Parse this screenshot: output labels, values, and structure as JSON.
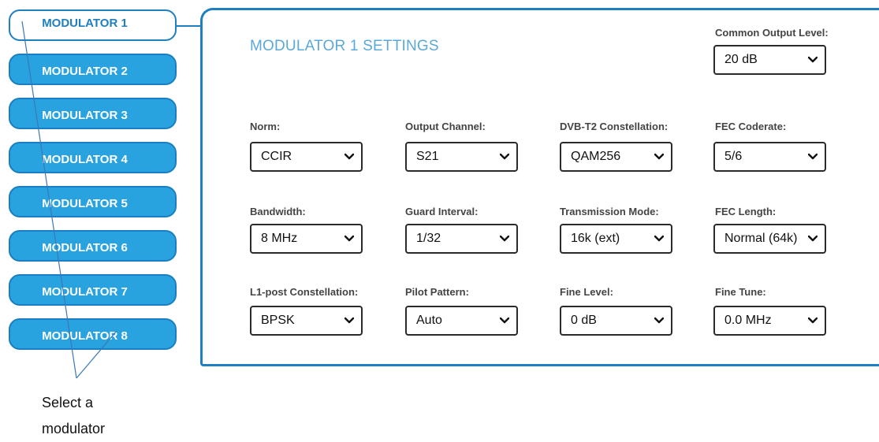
{
  "tabs": [
    {
      "label": "MODULATOR 1",
      "active": true
    },
    {
      "label": "MODULATOR 2",
      "active": false
    },
    {
      "label": "MODULATOR 3",
      "active": false
    },
    {
      "label": "MODULATOR 4",
      "active": false
    },
    {
      "label": "MODULATOR 5",
      "active": false
    },
    {
      "label": "MODULATOR 6",
      "active": false
    },
    {
      "label": "MODULATOR 7",
      "active": false
    },
    {
      "label": "MODULATOR 8",
      "active": false
    }
  ],
  "panel": {
    "title": "MODULATOR 1 SETTINGS",
    "common_output_level": {
      "label": "Common Output Level:",
      "value": "20 dB"
    },
    "fields": [
      {
        "label": "Norm:",
        "value": "CCIR"
      },
      {
        "label": "Output Channel:",
        "value": "S21"
      },
      {
        "label": "DVB-T2 Constellation:",
        "value": "QAM256"
      },
      {
        "label": "FEC Coderate:",
        "value": "5/6"
      },
      {
        "label": "Bandwidth:",
        "value": "8 MHz"
      },
      {
        "label": "Guard Interval:",
        "value": "1/32"
      },
      {
        "label": "Transmission Mode:",
        "value": "16k (ext)"
      },
      {
        "label": "FEC Length:",
        "value": "Normal (64k)"
      },
      {
        "label": "L1-post Constellation:",
        "value": "BPSK"
      },
      {
        "label": "Pilot Pattern:",
        "value": "Auto"
      },
      {
        "label": "Fine Level:",
        "value": "0 dB"
      },
      {
        "label": "Fine Tune:",
        "value": "0.0 MHz"
      }
    ]
  },
  "annotation": {
    "line1": "Select a",
    "line2": "modulator"
  },
  "colors": {
    "accent": "#1e7fc1",
    "tab_fill": "#29a3e0",
    "title": "#5aa9d8"
  }
}
